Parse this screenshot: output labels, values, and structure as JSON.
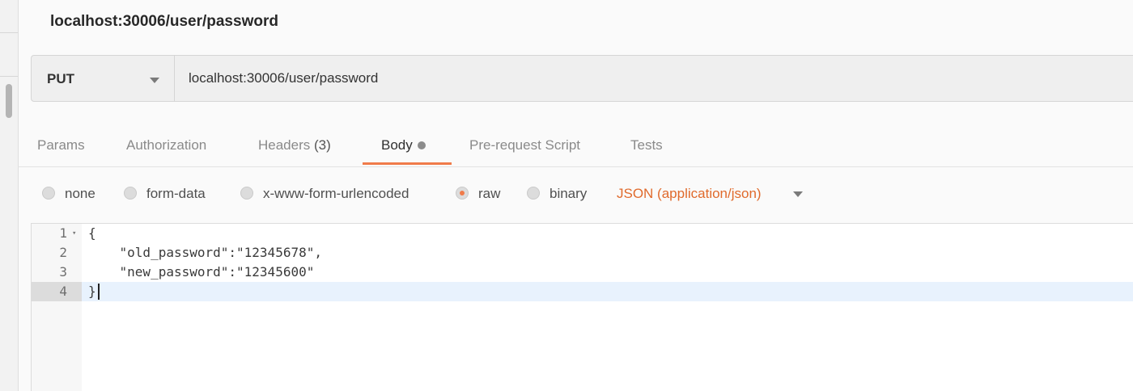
{
  "request": {
    "title": "localhost:30006/user/password",
    "method": "PUT",
    "url": "localhost:30006/user/password"
  },
  "tabs": [
    {
      "label": "Params"
    },
    {
      "label": "Authorization"
    },
    {
      "label": "Headers",
      "count": "(3)"
    },
    {
      "label": "Body",
      "active": true,
      "modified_indicator": true
    },
    {
      "label": "Pre-request Script"
    },
    {
      "label": "Tests"
    }
  ],
  "body_types": [
    {
      "label": "none",
      "selected": false
    },
    {
      "label": "form-data",
      "selected": false
    },
    {
      "label": "x-www-form-urlencoded",
      "selected": false
    },
    {
      "label": "raw",
      "selected": true
    },
    {
      "label": "binary",
      "selected": false
    }
  ],
  "content_type": "JSON (application/json)",
  "editor": {
    "lines": [
      {
        "num": "1",
        "text": "{"
      },
      {
        "num": "2",
        "text": "    \"old_password\":\"12345678\","
      },
      {
        "num": "3",
        "text": "    \"new_password\":\"12345600\""
      },
      {
        "num": "4",
        "text": "}"
      }
    ],
    "active_line": 4
  },
  "colors": {
    "accent": "#f07b4a",
    "content_type_text": "#e06a2c",
    "active_line_bg": "#e8f2fd"
  }
}
